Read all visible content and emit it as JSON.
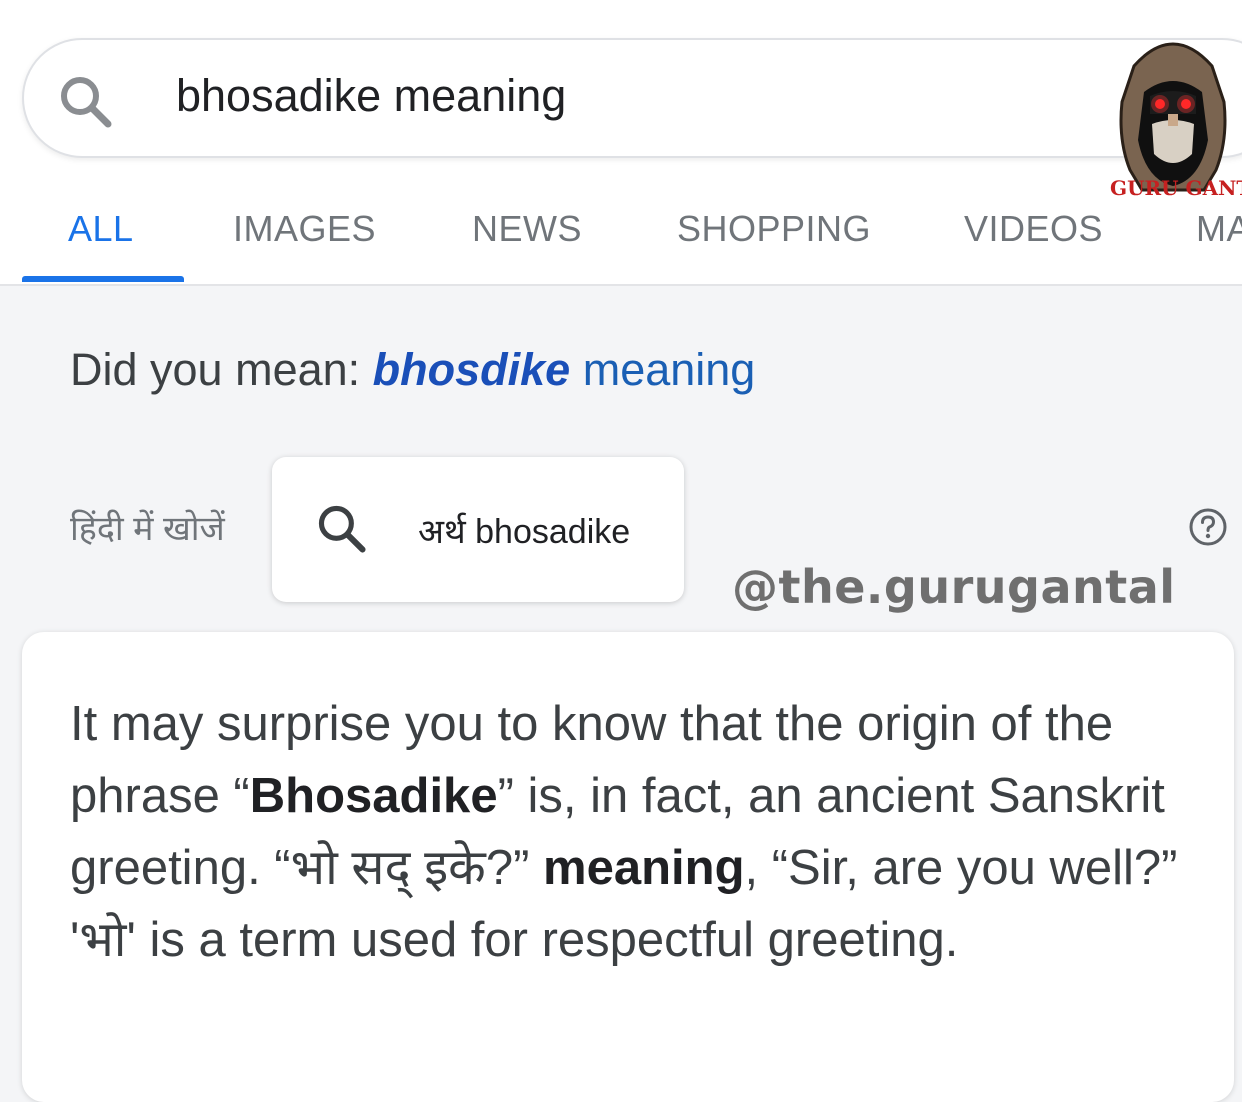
{
  "search": {
    "query": "bhosadike meaning",
    "icon": "search-icon"
  },
  "tabs": [
    {
      "label": "ALL",
      "active": true
    },
    {
      "label": "IMAGES",
      "active": false
    },
    {
      "label": "NEWS",
      "active": false
    },
    {
      "label": "SHOPPING",
      "active": false
    },
    {
      "label": "VIDEOS",
      "active": false
    },
    {
      "label": "MA",
      "active": false
    }
  ],
  "did_you_mean": {
    "prefix": "Did you mean: ",
    "bold_word": "bhosdike",
    "rest": " meaning"
  },
  "hindi_search": {
    "label": "हिंदी में खोजें",
    "chip_text": "अर्थ bhosadike"
  },
  "help_icon": "help-circle-icon",
  "watermark": "@the.gurugantal",
  "logo": {
    "text": "GURU GANTAL"
  },
  "answer": {
    "t1": "It may surprise you to know that the origin of the phrase “",
    "b1": "Bhosadike",
    "t2": "” is, in fact, an ancient Sanskrit greeting. “भो सद् इके?” ",
    "b2": "meaning",
    "t3": ", “Sir, are you well?” 'भो' is a term used for respectful greeting."
  },
  "colors": {
    "accent": "#1a73e8",
    "link": "#1a5fb4",
    "tab_inactive": "#70757a",
    "watermark": "#6f6f6f",
    "logo_text": "#c62020"
  }
}
